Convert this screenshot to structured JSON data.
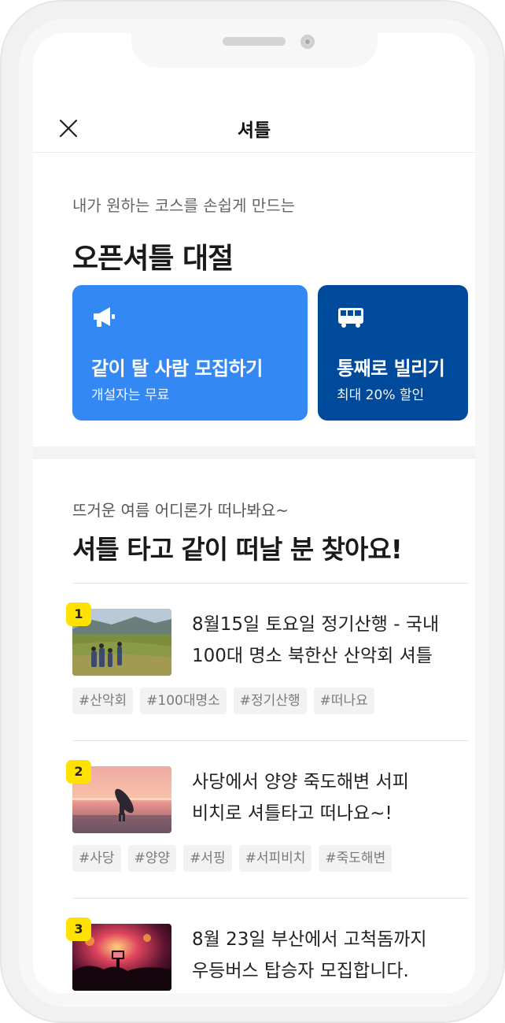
{
  "header": {
    "title": "셔틀",
    "close_icon": "close-icon"
  },
  "hero": {
    "subtitle": "내가 원하는 코스를 손쉽게 만드는",
    "title": "오픈셔틀 대절",
    "cards": [
      {
        "icon": "megaphone-icon",
        "title": "같이 탈 사람 모집하기",
        "subtitle": "개설자는 무료",
        "color": "#3388f4"
      },
      {
        "icon": "bus-icon",
        "title": "통째로 빌리기",
        "subtitle": "최대 20% 할인",
        "color": "#004a9c"
      }
    ]
  },
  "list": {
    "subtitle": "뜨거운 여름 어디론가 떠나봐요~",
    "title": "셔틀 타고 같이 떠날 분 찾아요!",
    "items": [
      {
        "rank": "1",
        "title_line1": "8월15일 토요일 정기산행 - 국내",
        "title_line2": "100대 명소 북한산 산악회 셔틀",
        "tags": [
          "#산악회",
          "#100대명소",
          "#정기산행",
          "#떠나요"
        ]
      },
      {
        "rank": "2",
        "title_line1": "사당에서 양양 죽도해변 서피",
        "title_line2": "비치로 셔틀타고 떠나요~!",
        "tags": [
          "#사당",
          "#양양",
          "#서핑",
          "#서피비치",
          "#죽도해변"
        ]
      },
      {
        "rank": "3",
        "title_line1": "8월 23일 부산에서 고척돔까지",
        "title_line2": "우등버스 탑승자 모집합니다.",
        "tags": []
      }
    ]
  },
  "colors": {
    "rank_badge": "#ffe200",
    "primary": "#3388f4",
    "dark_primary": "#004a9c"
  }
}
